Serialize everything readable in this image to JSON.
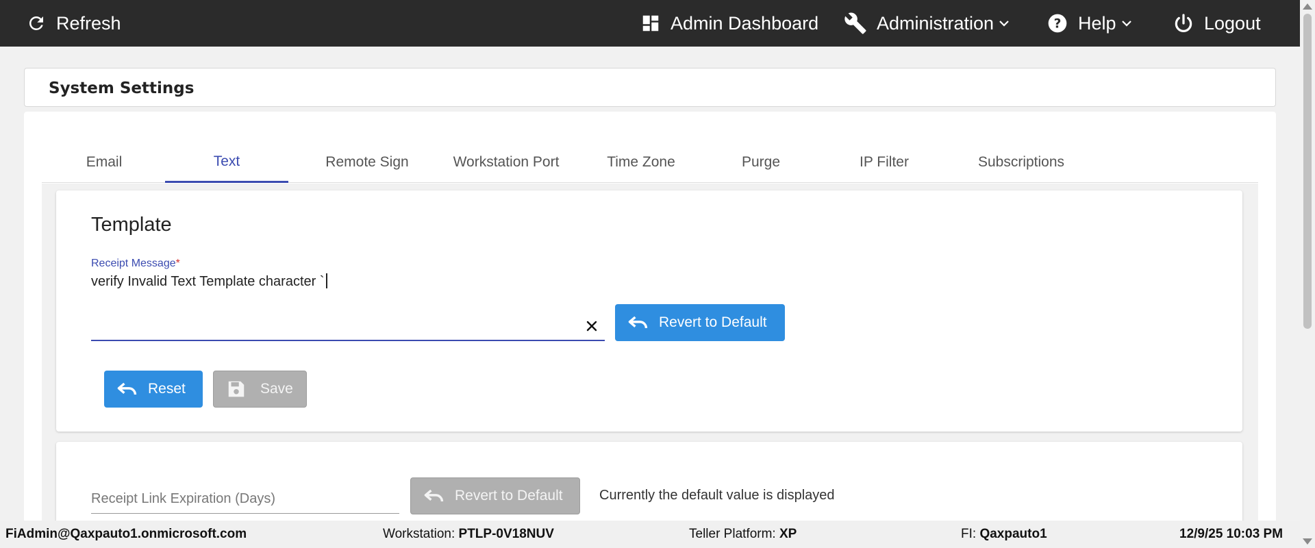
{
  "topbar": {
    "refresh_label": "Refresh",
    "admin_dashboard_label": "Admin Dashboard",
    "administration_label": "Administration",
    "help_label": "Help",
    "logout_label": "Logout"
  },
  "header": {
    "title": "System Settings"
  },
  "tabs": [
    {
      "label": "Email"
    },
    {
      "label": "Text"
    },
    {
      "label": "Remote Sign"
    },
    {
      "label": "Workstation Port"
    },
    {
      "label": "Time Zone"
    },
    {
      "label": "Purge"
    },
    {
      "label": "IP Filter"
    },
    {
      "label": "Subscriptions"
    }
  ],
  "active_tab": "Text",
  "template": {
    "title": "Template",
    "receipt_label": "Receipt Message",
    "required_mark": "*",
    "receipt_value": "verify Invalid Text Template character `",
    "revert_label": "Revert to Default",
    "reset_label": "Reset",
    "save_label": "Save"
  },
  "expiration": {
    "placeholder": "Receipt Link Expiration (Days)",
    "revert_label": "Revert to Default",
    "default_note": "Currently the default value is displayed"
  },
  "footer": {
    "user": "FiAdmin@Qaxpauto1.onmicrosoft.com",
    "workstation_label": "Workstation:",
    "workstation_value": "PTLP-0V18NUV",
    "teller_label": "Teller Platform:",
    "teller_value": "XP",
    "fi_label": "FI:",
    "fi_value": "Qaxpauto1",
    "datetime": "12/9/25 10:03 PM"
  },
  "colors": {
    "topbar_bg": "#2b2b2b",
    "accent": "#3b4bb0",
    "primary_button": "#2f8ee0",
    "disabled_button": "#b0b0b0",
    "required": "#d32f2f"
  },
  "icons": {
    "refresh": "refresh-icon",
    "dashboard": "dashboard-icon",
    "administration": "wrench-icon",
    "help": "help-circle-icon",
    "logout": "power-icon",
    "clear": "close-icon",
    "undo": "undo-icon",
    "save": "save-icon"
  }
}
